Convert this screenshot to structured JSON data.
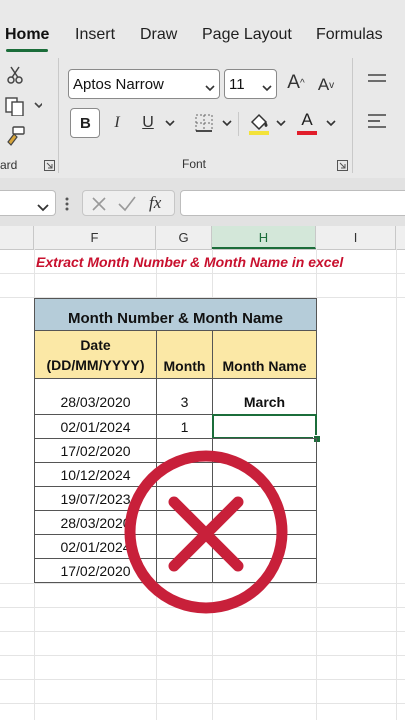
{
  "ribbon": {
    "tabs": [
      {
        "label": "Home",
        "active": true
      },
      {
        "label": "Insert"
      },
      {
        "label": "Draw"
      },
      {
        "label": "Page Layout"
      },
      {
        "label": "Formulas"
      }
    ],
    "font_name": "Aptos Narrow",
    "font_size": "11",
    "grow_font": "A",
    "shrink_font": "A",
    "bold": "B",
    "italic": "I",
    "underline": "U",
    "font_color_letter": "A",
    "font_group_label": "Font",
    "clipboard_group_label": "ard",
    "fill_color": "#f3e23a",
    "font_color": "#e11d2b"
  },
  "formula_bar": {
    "fx": "fx",
    "cancel_icon": "x-icon",
    "enter_icon": "check-icon"
  },
  "grid": {
    "columns": [
      "F",
      "G",
      "H",
      "I"
    ],
    "selected_column": "H",
    "banner": "Extract Month Number & Month Name in excel",
    "table": {
      "title": "Month Number & Month Name",
      "headers": [
        "Date\n(DD/MM/YYYY)",
        "Month",
        "Month Name"
      ],
      "rows": [
        {
          "date": "28/03/2020",
          "month": "3",
          "name": "March"
        },
        {
          "date": "02/01/2024",
          "month": "1",
          "name": ""
        },
        {
          "date": "17/02/2020",
          "month": "",
          "name": ""
        },
        {
          "date": "10/12/2024",
          "month": "",
          "name": ""
        },
        {
          "date": "19/07/2023",
          "month": "",
          "name": ""
        },
        {
          "date": "28/03/2020",
          "month": "",
          "name": ""
        },
        {
          "date": "02/01/2024",
          "month": "",
          "name": ""
        },
        {
          "date": "17/02/2020",
          "month": "",
          "name": ""
        }
      ]
    }
  },
  "overlay": {
    "icon": "wrong-cross-icon",
    "color": "#c8203a"
  }
}
